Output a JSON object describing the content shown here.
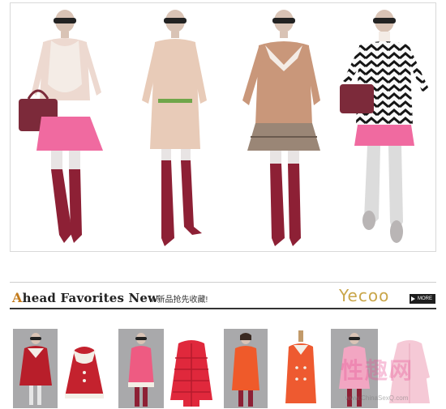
{
  "section": {
    "title_first_letter": "A",
    "title_rest": "head Favorites New",
    "title_cn": "/ 新品抢先收藏!",
    "brand": "Yecoo",
    "more_label": "MORE"
  },
  "watermark": {
    "logo_text": "性趣网",
    "url": "www.ChinaSexQ.com"
  },
  "colors": {
    "accent_letter": "#c27a1b",
    "brand_gold": "#c9a64a",
    "rule_dark": "#333333"
  },
  "hero_models": [
    {
      "name": "model-pink-skirt-bag"
    },
    {
      "name": "model-lace-dress"
    },
    {
      "name": "model-tiered-skirt"
    },
    {
      "name": "model-zigzag-sweater"
    }
  ],
  "thumbnails": [
    {
      "name": "thumb-red-cape-model"
    },
    {
      "name": "thumb-red-cape-product"
    },
    {
      "name": "thumb-pink-coat-model"
    },
    {
      "name": "thumb-red-puffer-jacket"
    },
    {
      "name": "thumb-orange-coat-model"
    },
    {
      "name": "thumb-orange-coat-mannequin"
    },
    {
      "name": "thumb-pink-dress-model"
    },
    {
      "name": "thumb-pink-coat-product"
    }
  ]
}
